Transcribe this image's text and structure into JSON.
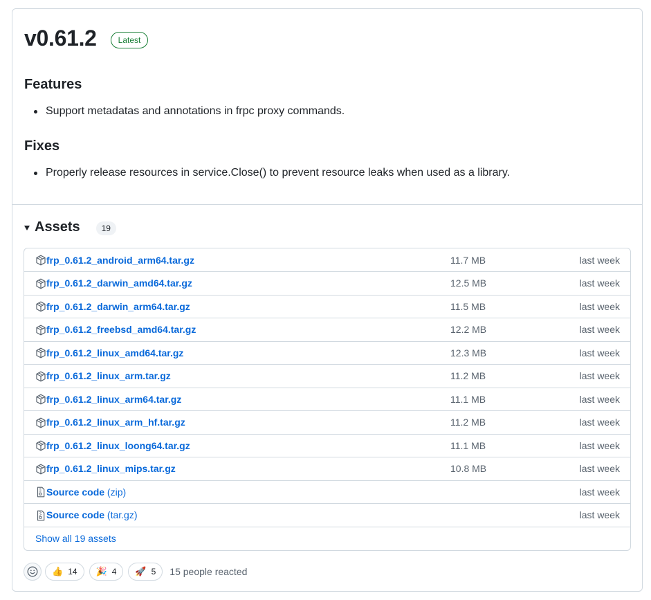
{
  "release": {
    "version": "v0.61.2",
    "badge": "Latest"
  },
  "notes": {
    "features_title": "Features",
    "features": [
      "Support metadatas and annotations in frpc proxy commands."
    ],
    "fixes_title": "Fixes",
    "fixes": [
      "Properly release resources in service.Close() to prevent resource leaks when used as a library."
    ]
  },
  "assets": {
    "title": "Assets",
    "count": "19",
    "rows": [
      {
        "icon": "package-icon",
        "name": "frp_0.61.2_android_arm64.tar.gz",
        "suffix": "",
        "size": "11.7 MB",
        "date": "last week"
      },
      {
        "icon": "package-icon",
        "name": "frp_0.61.2_darwin_amd64.tar.gz",
        "suffix": "",
        "size": "12.5 MB",
        "date": "last week"
      },
      {
        "icon": "package-icon",
        "name": "frp_0.61.2_darwin_arm64.tar.gz",
        "suffix": "",
        "size": "11.5 MB",
        "date": "last week"
      },
      {
        "icon": "package-icon",
        "name": "frp_0.61.2_freebsd_amd64.tar.gz",
        "suffix": "",
        "size": "12.2 MB",
        "date": "last week"
      },
      {
        "icon": "package-icon",
        "name": "frp_0.61.2_linux_amd64.tar.gz",
        "suffix": "",
        "size": "12.3 MB",
        "date": "last week"
      },
      {
        "icon": "package-icon",
        "name": "frp_0.61.2_linux_arm.tar.gz",
        "suffix": "",
        "size": "11.2 MB",
        "date": "last week"
      },
      {
        "icon": "package-icon",
        "name": "frp_0.61.2_linux_arm64.tar.gz",
        "suffix": "",
        "size": "11.1 MB",
        "date": "last week"
      },
      {
        "icon": "package-icon",
        "name": "frp_0.61.2_linux_arm_hf.tar.gz",
        "suffix": "",
        "size": "11.2 MB",
        "date": "last week"
      },
      {
        "icon": "package-icon",
        "name": "frp_0.61.2_linux_loong64.tar.gz",
        "suffix": "",
        "size": "11.1 MB",
        "date": "last week"
      },
      {
        "icon": "package-icon",
        "name": "frp_0.61.2_linux_mips.tar.gz",
        "suffix": "",
        "size": "10.8 MB",
        "date": "last week"
      },
      {
        "icon": "file-zip-icon",
        "name": "Source code",
        "suffix": " (zip)",
        "size": "",
        "date": "last week"
      },
      {
        "icon": "file-zip-icon",
        "name": "Source code",
        "suffix": " (tar.gz)",
        "size": "",
        "date": "last week"
      }
    ],
    "show_all": "Show all 19 assets"
  },
  "reactions": {
    "items": [
      {
        "emoji": "👍",
        "icon": "thumbs-up-icon",
        "count": "14"
      },
      {
        "emoji": "🎉",
        "icon": "party-popper-icon",
        "count": "4"
      },
      {
        "emoji": "🚀",
        "icon": "rocket-icon",
        "count": "5"
      }
    ],
    "summary": "15 people reacted"
  },
  "colors": {
    "link": "#0969da",
    "badge_green": "#1a7f37",
    "muted": "#59636e",
    "border": "#d1d9e0"
  }
}
